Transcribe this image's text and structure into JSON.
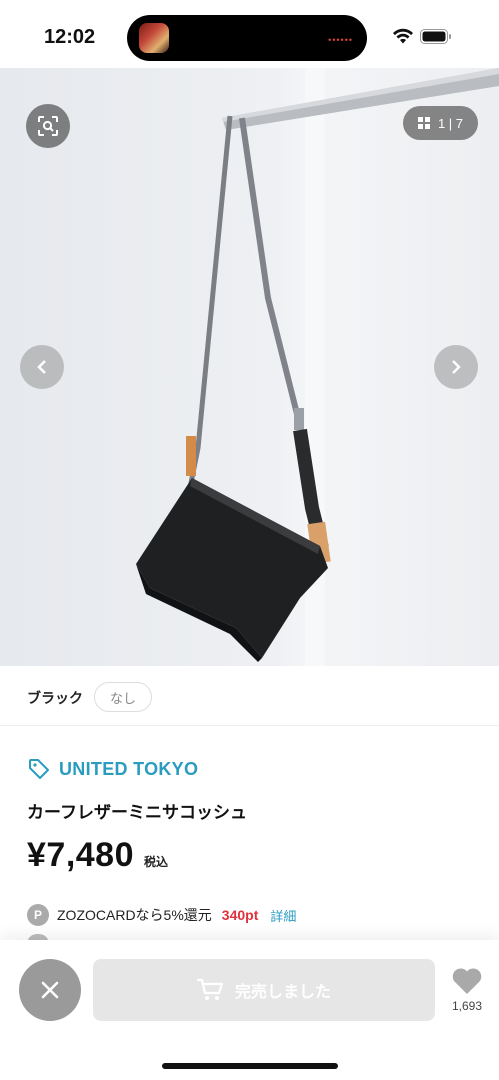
{
  "status_bar": {
    "time": "12:02",
    "island_dots": "••••••"
  },
  "gallery": {
    "current_page": 1,
    "total_pages": 7,
    "counter_text": "1 | 7"
  },
  "variant": {
    "color": "ブラック",
    "size": "なし"
  },
  "product": {
    "brand": "UNITED TOKYO",
    "name": "カーフレザーミニサコッシュ",
    "price": "¥7,480",
    "tax_label": "税込"
  },
  "points": {
    "badge": "P",
    "text": "ZOZOCARDなら5%還元",
    "value": "340pt",
    "detail_link": "詳細"
  },
  "bottom_bar": {
    "soldout_label": "完売しました",
    "favorite_count": "1,693"
  },
  "colors": {
    "brand_accent": "#2a9cc0",
    "points_red": "#e0323c",
    "disabled_button": "#e6e6e6"
  }
}
